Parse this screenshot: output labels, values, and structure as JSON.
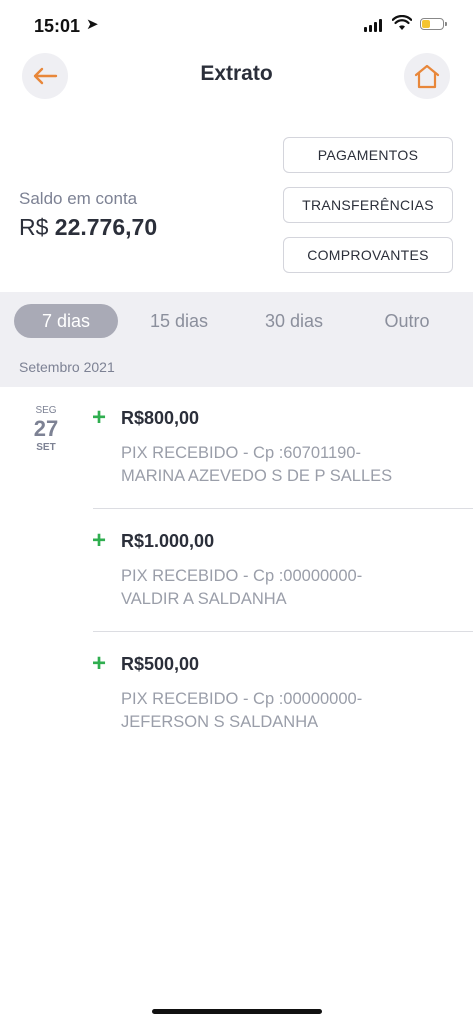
{
  "status_bar": {
    "time": "15:01"
  },
  "header": {
    "title": "Extrato"
  },
  "balance": {
    "label": "Saldo em conta",
    "currency": "R$",
    "value": "22.776,70"
  },
  "actions": {
    "payments": "PAGAMENTOS",
    "transfers": "TRANSFERÊNCIAS",
    "receipts": "COMPROVANTES"
  },
  "filters": {
    "items": [
      "7 dias",
      "15 dias",
      "30 dias",
      "Outro"
    ],
    "selected": "7 dias"
  },
  "month_header": "Setembro 2021",
  "date": {
    "weekday": "SEG",
    "day": "27",
    "month": "SET"
  },
  "transactions": [
    {
      "sign": "+",
      "amount": "R$800,00",
      "description_line1": "PIX RECEBIDO - Cp :60701190-",
      "description_line2": "MARINA AZEVEDO S DE P SALLES"
    },
    {
      "sign": "+",
      "amount": "R$1.000,00",
      "description_line1": "PIX RECEBIDO - Cp :00000000-",
      "description_line2": "VALDIR A SALDANHA"
    },
    {
      "sign": "+",
      "amount": "R$500,00",
      "description_line1": "PIX RECEBIDO - Cp :00000000-",
      "description_line2": "JEFERSON S SALDANHA"
    }
  ],
  "icons": {
    "back": "back-arrow-icon",
    "home": "home-icon",
    "signal": "cellular-signal-icon",
    "wifi": "wifi-icon",
    "battery": "battery-icon",
    "location": "location-arrow-icon"
  },
  "colors": {
    "accent": "#e8873a",
    "credit": "#2fae4f",
    "active_filter": "#a9aab6",
    "battery_fill": "#f4c430"
  }
}
